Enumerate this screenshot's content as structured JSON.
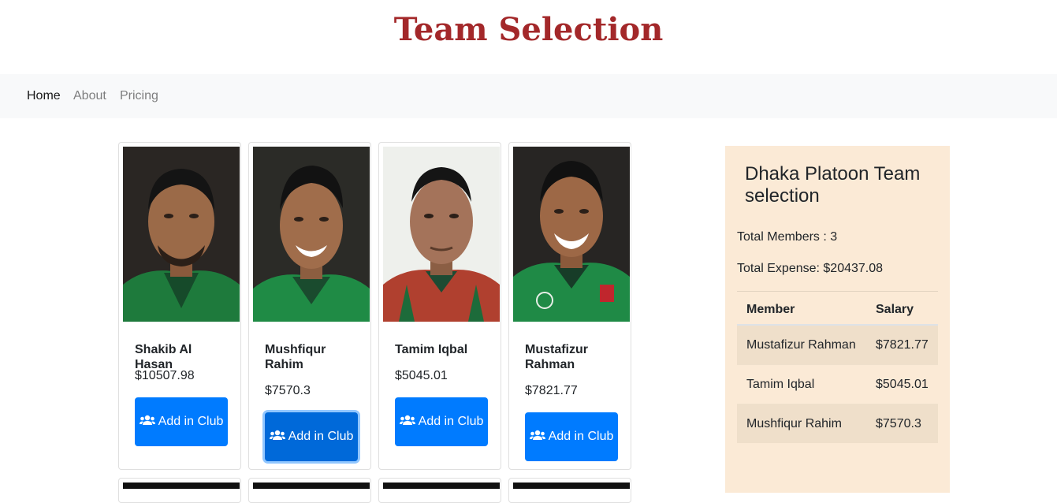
{
  "header": {
    "title": "Team Selection"
  },
  "nav": {
    "items": [
      "Home",
      "About",
      "Pricing"
    ],
    "active": "Home"
  },
  "players": [
    {
      "name": "Shakib Al Hasan",
      "salary": "$10507.98",
      "button_label": "Add in Club"
    },
    {
      "name": "Mushfiqur Rahim",
      "salary": "$7570.3",
      "button_label": "Add in Club"
    },
    {
      "name": "Tamim Iqbal",
      "salary": "$5045.01",
      "button_label": "Add in Club"
    },
    {
      "name": "Mustafizur Rahman",
      "salary": "$7821.77",
      "button_label": "Add in Club"
    }
  ],
  "summary": {
    "title": "Dhaka Platoon Team selection",
    "total_members": "Total Members : 3",
    "total_expense": "Total Expense: $20437.08",
    "table": {
      "headers": [
        "Member",
        "Salary"
      ],
      "rows": [
        [
          "Mustafizur Rahman",
          "$7821.77"
        ],
        [
          "Tamim Iqbal",
          "$5045.01"
        ],
        [
          "Mushfiqur Rahim",
          "$7570.3"
        ]
      ]
    }
  },
  "colors": {
    "title": "#a3282a",
    "button": "#007bff",
    "panel_bg": "#fbead6"
  }
}
